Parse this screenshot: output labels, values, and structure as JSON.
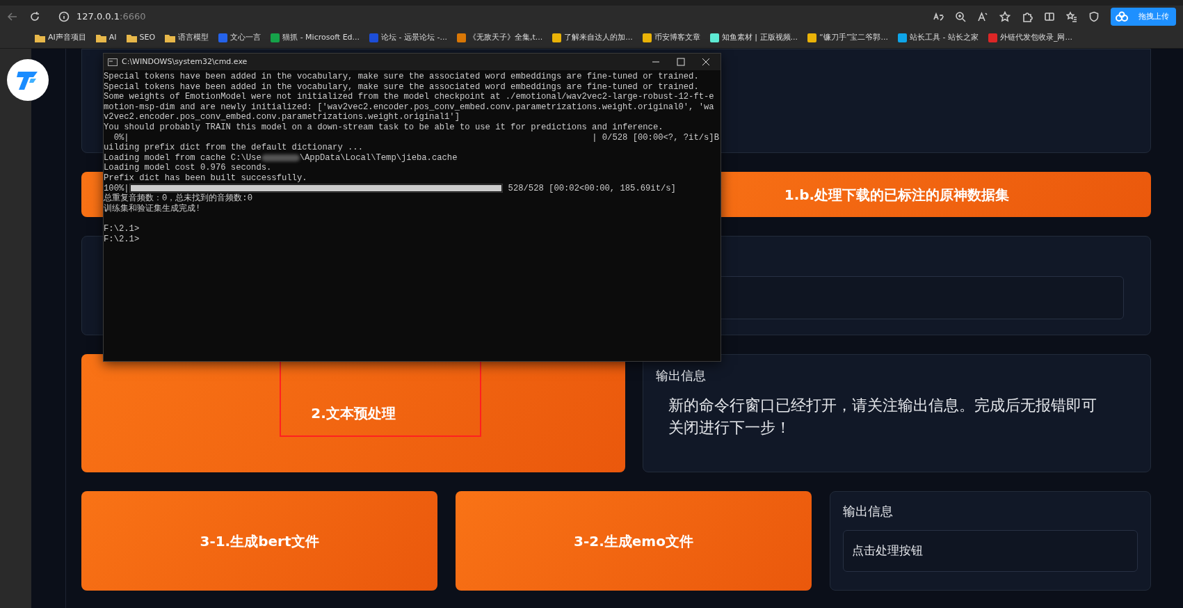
{
  "browser": {
    "address": {
      "host": "127.0.0.1",
      "port": ":6660"
    },
    "upload_button": "拖拽上传",
    "bookmarks": [
      {
        "label": "AI声音项目",
        "kind": "folder"
      },
      {
        "label": "AI",
        "kind": "folder"
      },
      {
        "label": "SEO",
        "kind": "folder"
      },
      {
        "label": "语言模型",
        "kind": "folder"
      },
      {
        "label": "文心一言",
        "kind": "site",
        "color": "#2563eb"
      },
      {
        "label": "猫抓 - Microsoft Ed...",
        "kind": "site",
        "color": "#16a34a"
      },
      {
        "label": "论坛 - 远景论坛 -...",
        "kind": "site",
        "color": "#1d4ed8"
      },
      {
        "label": "《无敌天子》全集,t...",
        "kind": "site",
        "color": "#d97706"
      },
      {
        "label": "了解来自达人的加...",
        "kind": "site",
        "color": "#eab308"
      },
      {
        "label": "币安博客文章",
        "kind": "site",
        "color": "#eab308"
      },
      {
        "label": "知鱼素材 | 正版视频...",
        "kind": "site",
        "color": "#5eead4"
      },
      {
        "label": "“镰刀手”宝二爷郭...",
        "kind": "site",
        "color": "#eab308"
      },
      {
        "label": "站长工具 - 站长之家",
        "kind": "site",
        "color": "#0ea5e9"
      },
      {
        "label": "外链代发包收录_网...",
        "kind": "site",
        "color": "#dc2626"
      }
    ]
  },
  "terminal": {
    "title": "C:\\WINDOWS\\system32\\cmd.exe",
    "lines": [
      {
        "kind": "text",
        "text": "Special tokens have been added in the vocabulary, make sure the associated word embeddings are fine-tuned or trained."
      },
      {
        "kind": "text",
        "text": "Special tokens have been added in the vocabulary, make sure the associated word embeddings are fine-tuned or trained."
      },
      {
        "kind": "text",
        "text": "Some weights of EmotionModel were not initialized from the model checkpoint at ./emotional/wav2vec2-large-robust-12-ft-e"
      },
      {
        "kind": "text",
        "text": "motion-msp-dim and are newly initialized: ['wav2vec2.encoder.pos_conv_embed.conv.parametrizations.weight.original0', 'wa"
      },
      {
        "kind": "text",
        "text": "v2vec2.encoder.pos_conv_embed.conv.parametrizations.weight.original1']"
      },
      {
        "kind": "text",
        "text": "You should probably TRAIN this model on a down-stream task to be able to use it for predictions and inference."
      },
      {
        "kind": "progress",
        "percent": "  0%|",
        "reading": "| 0/528 [00:00<?, ?it/s]B"
      },
      {
        "kind": "text",
        "text": "uilding prefix dict from the default dictionary ..."
      },
      {
        "kind": "redacted",
        "before": "Loading model from cache C:\\Use",
        "after": "\\AppData\\Local\\Temp\\jieba.cache"
      },
      {
        "kind": "text",
        "text": "Loading model cost 0.976 seconds."
      },
      {
        "kind": "text",
        "text": "Prefix dict has been built successfully."
      },
      {
        "kind": "progress",
        "percent": "100%|",
        "level": 1,
        "reading": "528/528 [00:02<00:00, 185.69it/s]"
      },
      {
        "kind": "text",
        "text": "总重复音频数：0，总未找到的音频数:0"
      },
      {
        "kind": "text",
        "text": "训练集和验证集生成完成!"
      },
      {
        "kind": "blank"
      },
      {
        "kind": "text",
        "text": "F:\\2.1>"
      },
      {
        "kind": "text",
        "text": "F:\\2.1>"
      }
    ]
  },
  "page": {
    "step_1b": {
      "label": "1.b.处理下载的已标注的原神数据集"
    },
    "step_2": {
      "label": "2.文本预处理",
      "highlighted": true
    },
    "step_2_output": {
      "title": "输出信息",
      "text": "新的命令行窗口已经打开，请关注输出信息。完成后无报错即可关闭进行下一步！"
    },
    "step_3_buttons": [
      {
        "label": "3-1.生成bert文件"
      },
      {
        "label": "3-2.生成emo文件"
      }
    ],
    "step_3_output": {
      "title": "输出信息",
      "value": "点击处理按钮"
    }
  }
}
